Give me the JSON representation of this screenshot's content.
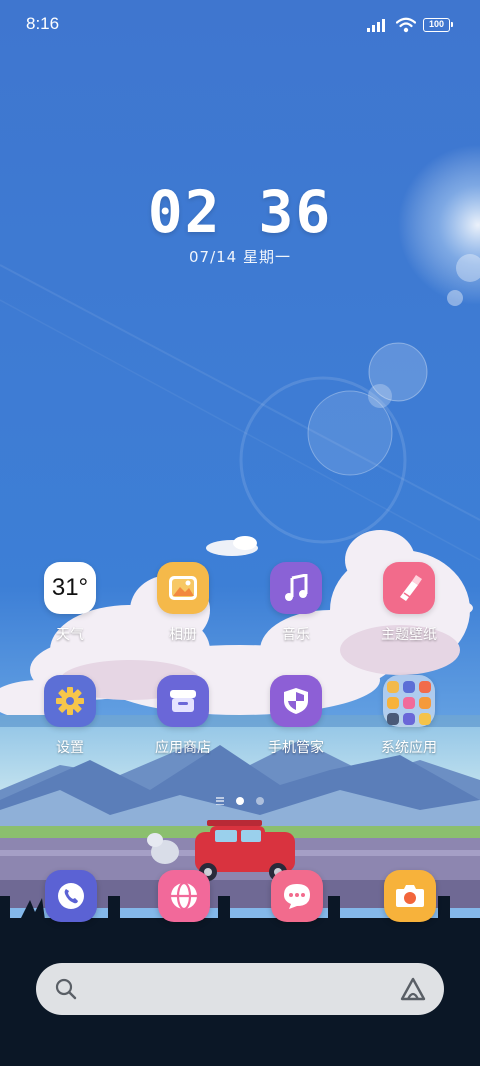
{
  "status_bar": {
    "time": "8:16",
    "battery": "100"
  },
  "clock": {
    "time": "02 36",
    "date": "07/14  星期一"
  },
  "apps": [
    {
      "label": "天气",
      "icon": "weather-icon",
      "temp": "31°"
    },
    {
      "label": "相册",
      "icon": "gallery-icon"
    },
    {
      "label": "音乐",
      "icon": "music-icon"
    },
    {
      "label": "主题壁纸",
      "icon": "brush-icon"
    },
    {
      "label": "设置",
      "icon": "gear-icon"
    },
    {
      "label": "应用商店",
      "icon": "store-icon"
    },
    {
      "label": "手机管家",
      "icon": "shield-icon"
    },
    {
      "label": "系统应用",
      "icon": "folder-icon"
    }
  ],
  "dock": [
    {
      "icon": "phone-icon"
    },
    {
      "icon": "browser-icon"
    },
    {
      "icon": "message-icon"
    },
    {
      "icon": "camera-icon"
    }
  ],
  "page_indicator": {
    "current": 2,
    "total": 3
  },
  "colors": {
    "sky_top": "#3d73cc",
    "sky_bottom": "#7eb6e8",
    "gallery": "#f5b94a",
    "music": "#8a62d6",
    "theme": "#f26b8b",
    "settings": "#5c6fd6",
    "store": "#6a67d8",
    "manager": "#8d5fd6",
    "phone": "#5b62d4",
    "browser": "#f2699a",
    "message": "#f26b8d",
    "camera": "#f7b23b"
  }
}
